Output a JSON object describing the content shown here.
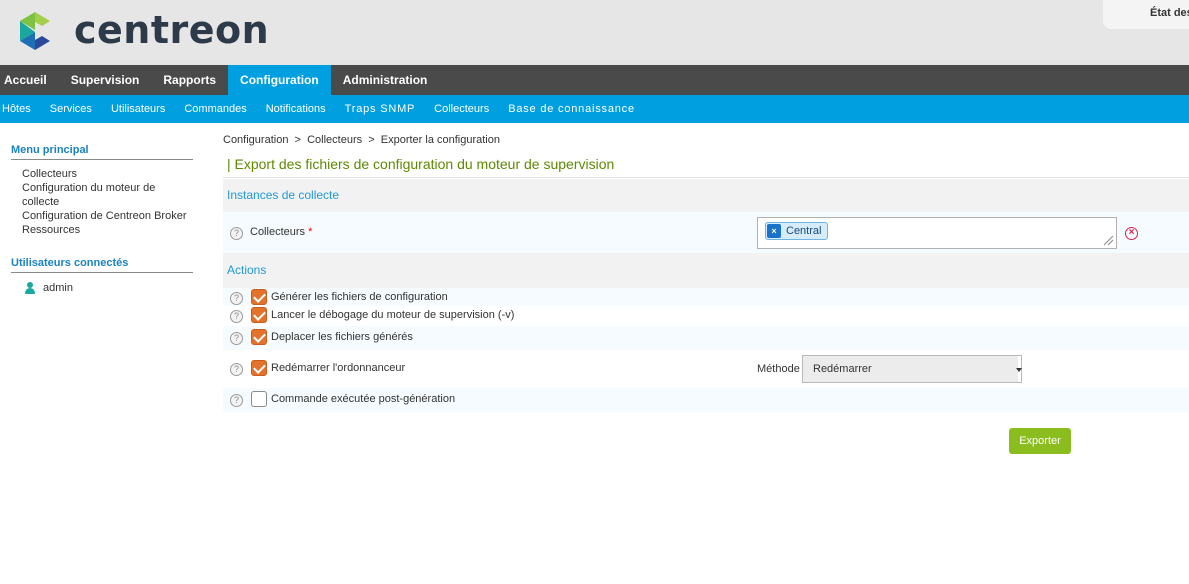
{
  "app": {
    "logo_text": "centreon",
    "status_label": "État des"
  },
  "main_nav": {
    "items": [
      "Accueil",
      "Supervision",
      "Rapports",
      "Configuration",
      "Administration"
    ],
    "active": "Configuration"
  },
  "sub_nav": {
    "items": [
      "Hôtes",
      "Services",
      "Utilisateurs",
      "Commandes",
      "Notifications",
      "Traps SNMP",
      "Collecteurs",
      "Base de connaissance"
    ]
  },
  "sidebar": {
    "menu_title": "Menu principal",
    "menu_items": [
      "Collecteurs",
      "Configuration du moteur de collecte",
      "Configuration de Centreon Broker",
      "Ressources"
    ],
    "users_title": "Utilisateurs connectés",
    "users": [
      "admin"
    ]
  },
  "breadcrumb": "Configuration  >  Collecteurs  >  Exporter la configuration",
  "page_title": "| Export des fichiers de configuration du moteur de supervision",
  "instances": {
    "section_title": "Instances de collecte",
    "field_label": "Collecteurs",
    "required_mark": "*",
    "selected_tag": "Central",
    "help": "?"
  },
  "actions": {
    "section_title": "Actions",
    "items": [
      {
        "label": "Générer les fichiers de configuration",
        "checked": true
      },
      {
        "label": "Lancer le débogage du moteur de supervision (-v)",
        "checked": true
      },
      {
        "label": "Deplacer les fichiers générés",
        "checked": true
      },
      {
        "label": "Redémarrer l'ordonnanceur",
        "checked": true
      },
      {
        "label": "Commande exécutée post-génération",
        "checked": false
      }
    ],
    "method_label": "Méthode",
    "method_value": "Redémarrer"
  },
  "buttons": {
    "export": "Exporter"
  },
  "colors": {
    "brand_blue": "#009fdf",
    "nav_dark": "#4a4a4a",
    "title_green": "#5e8a00",
    "checkbox_orange": "#e3722d",
    "export_green": "#8bbd1f"
  }
}
